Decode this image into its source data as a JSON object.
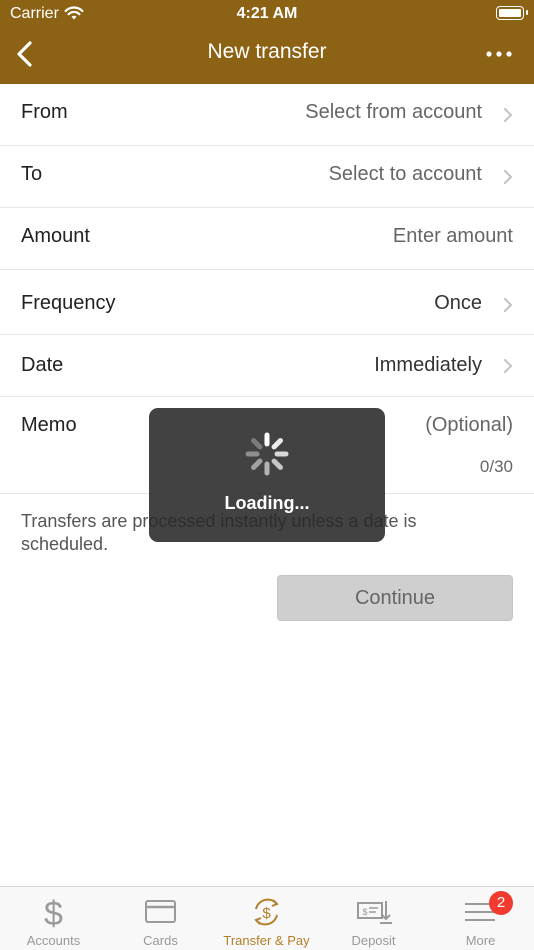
{
  "status_bar": {
    "carrier": "Carrier",
    "time": "4:21 AM"
  },
  "nav": {
    "title": "New transfer",
    "back_icon": "chevron-left-icon",
    "more_icon": "ellipsis-icon"
  },
  "form": {
    "from": {
      "label": "From",
      "value": "Select from account"
    },
    "to": {
      "label": "To",
      "value": "Select to account"
    },
    "amount": {
      "label": "Amount",
      "placeholder": "Enter amount"
    },
    "frequency": {
      "label": "Frequency",
      "value": "Once"
    },
    "date": {
      "label": "Date",
      "value": "Immediately"
    },
    "memo": {
      "label": "Memo",
      "placeholder": "(Optional)",
      "count": "0/30"
    }
  },
  "note": "Transfers are processed instantly unless a date is scheduled.",
  "continue_label": "Continue",
  "loading": {
    "text": "Loading..."
  },
  "tabs": [
    {
      "label": "Accounts",
      "icon": "dollar-icon"
    },
    {
      "label": "Cards",
      "icon": "card-icon"
    },
    {
      "label": "Transfer & Pay",
      "icon": "transfer-icon",
      "active": true
    },
    {
      "label": "Deposit",
      "icon": "check-deposit-icon"
    },
    {
      "label": "More",
      "icon": "menu-icon",
      "badge": "2"
    }
  ],
  "colors": {
    "header": "#8c6214",
    "accent": "#b37f2a",
    "badge": "#f23a2f"
  }
}
